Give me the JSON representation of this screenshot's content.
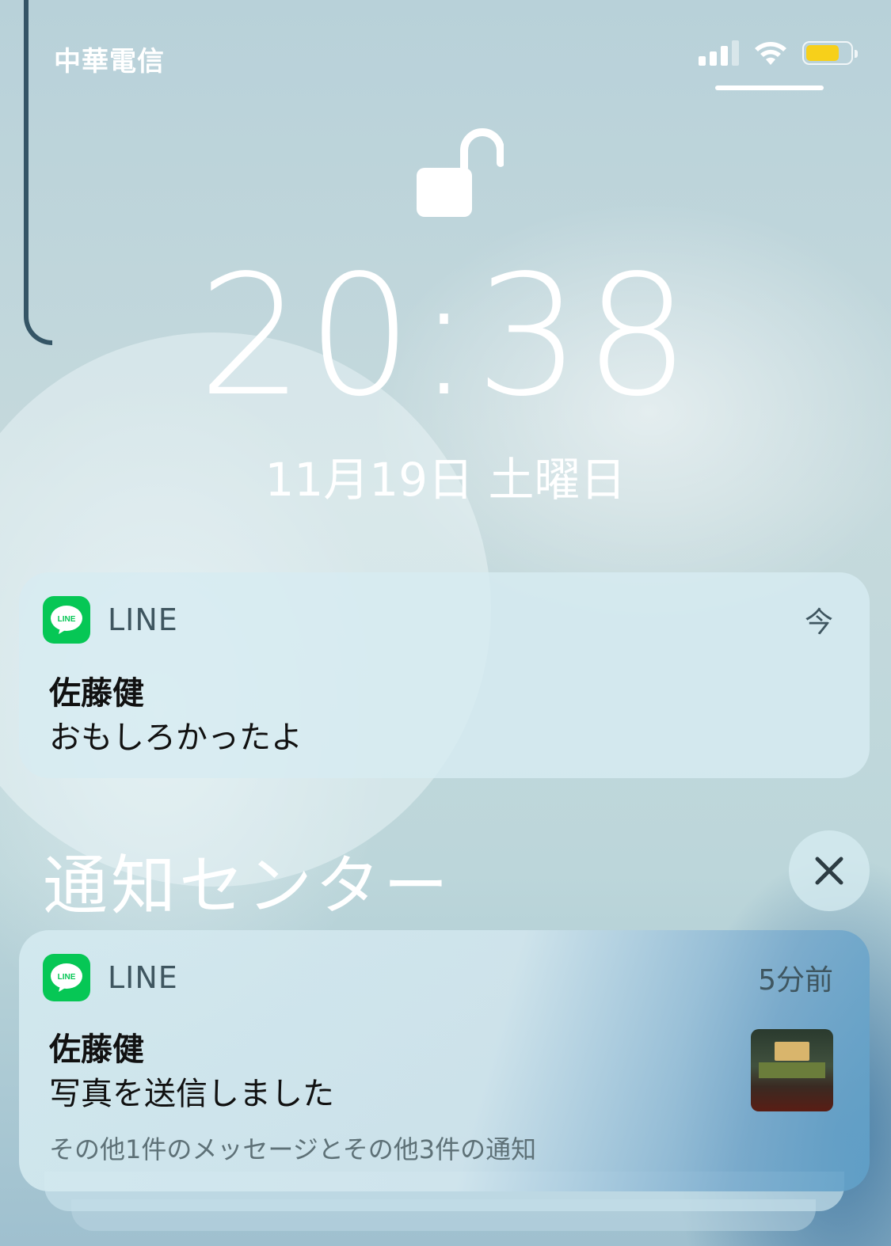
{
  "status_bar": {
    "carrier": "中華電信",
    "signal_bars": 3,
    "signal_total": 4,
    "battery_level": 0.75,
    "battery_color": "#f7d01a"
  },
  "lock_screen": {
    "lock_icon": "unlocked-padlock-icon",
    "time": "20:38",
    "date": "11月19日 土曜日"
  },
  "current_notification": {
    "app_icon": "line-app-icon",
    "app_name": "LINE",
    "app_icon_text": "LINE",
    "time": "今",
    "sender": "佐藤健",
    "message": "おもしろかったよ"
  },
  "notification_center": {
    "title": "通知センター",
    "close_icon": "close-icon",
    "notifications": [
      {
        "app_icon": "line-app-icon",
        "app_name": "LINE",
        "app_icon_text": "LINE",
        "time": "5分前",
        "sender": "佐藤健",
        "message": "写真を送信しました",
        "more": "その他1件のメッセージとその他3件の通知",
        "thumbnail": "photo-thumbnail"
      }
    ]
  },
  "colors": {
    "line_green": "#06c755",
    "text_dark": "#111111",
    "text_secondary": "#3f5660"
  }
}
